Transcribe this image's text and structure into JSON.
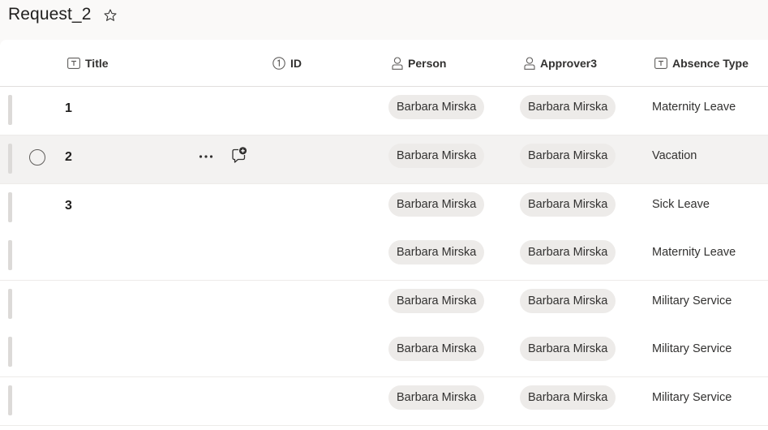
{
  "page": {
    "title": "Request_2",
    "favorite_icon": "star-outline-icon"
  },
  "columns": [
    {
      "label": "Title",
      "icon": "text-column-icon"
    },
    {
      "label": "ID",
      "icon": "number-column-icon"
    },
    {
      "label": "Person",
      "icon": "person-column-icon"
    },
    {
      "label": "Approver3",
      "icon": "person-column-icon"
    },
    {
      "label": "Absence Type",
      "icon": "text-column-icon"
    }
  ],
  "rows": [
    {
      "title": "1",
      "person": "Barbara Mirska",
      "approver": "Barbara Mirska",
      "absence_type": "Maternity Leave"
    },
    {
      "title": "2",
      "person": "Barbara Mirska",
      "approver": "Barbara Mirska",
      "absence_type": "Vacation"
    },
    {
      "title": "3",
      "person": "Barbara Mirska",
      "approver": "Barbara Mirska",
      "absence_type": "Sick Leave"
    },
    {
      "title": "",
      "person": "Barbara Mirska",
      "approver": "Barbara Mirska",
      "absence_type": "Maternity Leave"
    },
    {
      "title": "",
      "person": "Barbara Mirska",
      "approver": "Barbara Mirska",
      "absence_type": "Military Service"
    },
    {
      "title": "",
      "person": "Barbara Mirska",
      "approver": "Barbara Mirska",
      "absence_type": "Military Service"
    },
    {
      "title": "",
      "person": "Barbara Mirska",
      "approver": "Barbara Mirska",
      "absence_type": "Military Service"
    }
  ],
  "hovered_row_actions": {
    "more_icon": "more-horizontal-icon",
    "comment_icon": "add-comment-icon"
  },
  "colors": {
    "background": "#faf9f8",
    "grid": "#ffffff",
    "pill": "#edebe9",
    "selected_row": "#f3f2f1"
  }
}
